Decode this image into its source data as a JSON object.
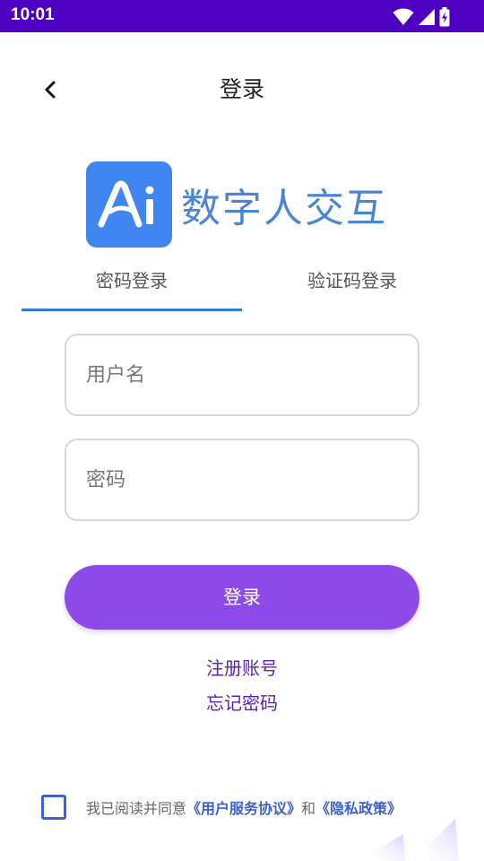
{
  "status_bar": {
    "time": "10:01",
    "icons": [
      "wifi-icon",
      "signal-icon",
      "battery-icon"
    ]
  },
  "nav": {
    "title": "登录"
  },
  "brand": {
    "logo_text": "Ai",
    "app_name": "数字人交互",
    "logo_color": "#3f86f0",
    "name_color": "#4a84d6"
  },
  "tabs": [
    {
      "label": "密码登录",
      "active": true
    },
    {
      "label": "验证码登录",
      "active": false
    }
  ],
  "form": {
    "username_placeholder": "用户名",
    "password_placeholder": "密码",
    "login_label": "登录"
  },
  "links": {
    "register": "注册账号",
    "forgot": "忘记密码"
  },
  "agreement": {
    "prefix": "我已阅读并同意",
    "user_service": "《用户服务协议》",
    "and": "和",
    "privacy": "《隐私政策》",
    "checked": false
  },
  "colors": {
    "status_bar": "#4d00c2",
    "primary_button": "#8e4ae8",
    "tab_indicator": "#2d7bd3",
    "link": "#5a1fb0"
  }
}
